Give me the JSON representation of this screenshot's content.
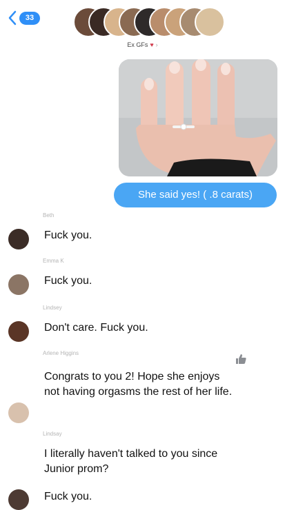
{
  "header": {
    "back_count": "33",
    "group_title": "Ex GFs",
    "heart": "♥",
    "chevron": "›"
  },
  "conversation": {
    "outgoing": {
      "image": "engagement-ring-hand-photo",
      "text": "She said yes! ( .8 carats)"
    },
    "messages": [
      {
        "sender": "Beth",
        "text": "Fuck you."
      },
      {
        "sender": "Emma K",
        "text": "Fuck you."
      },
      {
        "sender": "Lindsey",
        "text": "Don't care. Fuck you."
      },
      {
        "sender": "Arlene Higgins",
        "text": "Congrats to you 2! Hope she enjoys not having orgasms the rest of her life."
      },
      {
        "sender": "Lindsay",
        "text": "I literally haven't talked to you since Junior prom?"
      },
      {
        "sender": "",
        "text": "Fuck you."
      }
    ]
  },
  "colors": {
    "accent": "#2f8ff7",
    "outgoing_bubble": "#4aa6f4",
    "sender_label": "#b4b4b4"
  }
}
